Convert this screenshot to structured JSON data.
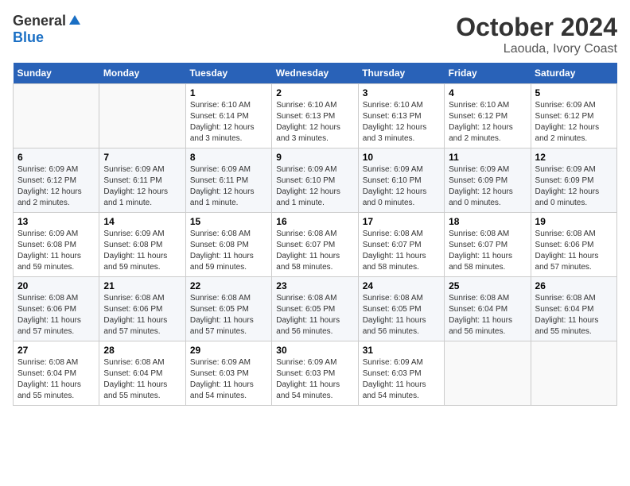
{
  "header": {
    "logo_general": "General",
    "logo_blue": "Blue",
    "title": "October 2024",
    "subtitle": "Laouda, Ivory Coast"
  },
  "weekdays": [
    "Sunday",
    "Monday",
    "Tuesday",
    "Wednesday",
    "Thursday",
    "Friday",
    "Saturday"
  ],
  "weeks": [
    [
      {
        "day": "",
        "info": ""
      },
      {
        "day": "",
        "info": ""
      },
      {
        "day": "1",
        "info": "Sunrise: 6:10 AM\nSunset: 6:14 PM\nDaylight: 12 hours and 3 minutes."
      },
      {
        "day": "2",
        "info": "Sunrise: 6:10 AM\nSunset: 6:13 PM\nDaylight: 12 hours and 3 minutes."
      },
      {
        "day": "3",
        "info": "Sunrise: 6:10 AM\nSunset: 6:13 PM\nDaylight: 12 hours and 3 minutes."
      },
      {
        "day": "4",
        "info": "Sunrise: 6:10 AM\nSunset: 6:12 PM\nDaylight: 12 hours and 2 minutes."
      },
      {
        "day": "5",
        "info": "Sunrise: 6:09 AM\nSunset: 6:12 PM\nDaylight: 12 hours and 2 minutes."
      }
    ],
    [
      {
        "day": "6",
        "info": "Sunrise: 6:09 AM\nSunset: 6:12 PM\nDaylight: 12 hours and 2 minutes."
      },
      {
        "day": "7",
        "info": "Sunrise: 6:09 AM\nSunset: 6:11 PM\nDaylight: 12 hours and 1 minute."
      },
      {
        "day": "8",
        "info": "Sunrise: 6:09 AM\nSunset: 6:11 PM\nDaylight: 12 hours and 1 minute."
      },
      {
        "day": "9",
        "info": "Sunrise: 6:09 AM\nSunset: 6:10 PM\nDaylight: 12 hours and 1 minute."
      },
      {
        "day": "10",
        "info": "Sunrise: 6:09 AM\nSunset: 6:10 PM\nDaylight: 12 hours and 0 minutes."
      },
      {
        "day": "11",
        "info": "Sunrise: 6:09 AM\nSunset: 6:09 PM\nDaylight: 12 hours and 0 minutes."
      },
      {
        "day": "12",
        "info": "Sunrise: 6:09 AM\nSunset: 6:09 PM\nDaylight: 12 hours and 0 minutes."
      }
    ],
    [
      {
        "day": "13",
        "info": "Sunrise: 6:09 AM\nSunset: 6:08 PM\nDaylight: 11 hours and 59 minutes."
      },
      {
        "day": "14",
        "info": "Sunrise: 6:09 AM\nSunset: 6:08 PM\nDaylight: 11 hours and 59 minutes."
      },
      {
        "day": "15",
        "info": "Sunrise: 6:08 AM\nSunset: 6:08 PM\nDaylight: 11 hours and 59 minutes."
      },
      {
        "day": "16",
        "info": "Sunrise: 6:08 AM\nSunset: 6:07 PM\nDaylight: 11 hours and 58 minutes."
      },
      {
        "day": "17",
        "info": "Sunrise: 6:08 AM\nSunset: 6:07 PM\nDaylight: 11 hours and 58 minutes."
      },
      {
        "day": "18",
        "info": "Sunrise: 6:08 AM\nSunset: 6:07 PM\nDaylight: 11 hours and 58 minutes."
      },
      {
        "day": "19",
        "info": "Sunrise: 6:08 AM\nSunset: 6:06 PM\nDaylight: 11 hours and 57 minutes."
      }
    ],
    [
      {
        "day": "20",
        "info": "Sunrise: 6:08 AM\nSunset: 6:06 PM\nDaylight: 11 hours and 57 minutes."
      },
      {
        "day": "21",
        "info": "Sunrise: 6:08 AM\nSunset: 6:06 PM\nDaylight: 11 hours and 57 minutes."
      },
      {
        "day": "22",
        "info": "Sunrise: 6:08 AM\nSunset: 6:05 PM\nDaylight: 11 hours and 57 minutes."
      },
      {
        "day": "23",
        "info": "Sunrise: 6:08 AM\nSunset: 6:05 PM\nDaylight: 11 hours and 56 minutes."
      },
      {
        "day": "24",
        "info": "Sunrise: 6:08 AM\nSunset: 6:05 PM\nDaylight: 11 hours and 56 minutes."
      },
      {
        "day": "25",
        "info": "Sunrise: 6:08 AM\nSunset: 6:04 PM\nDaylight: 11 hours and 56 minutes."
      },
      {
        "day": "26",
        "info": "Sunrise: 6:08 AM\nSunset: 6:04 PM\nDaylight: 11 hours and 55 minutes."
      }
    ],
    [
      {
        "day": "27",
        "info": "Sunrise: 6:08 AM\nSunset: 6:04 PM\nDaylight: 11 hours and 55 minutes."
      },
      {
        "day": "28",
        "info": "Sunrise: 6:08 AM\nSunset: 6:04 PM\nDaylight: 11 hours and 55 minutes."
      },
      {
        "day": "29",
        "info": "Sunrise: 6:09 AM\nSunset: 6:03 PM\nDaylight: 11 hours and 54 minutes."
      },
      {
        "day": "30",
        "info": "Sunrise: 6:09 AM\nSunset: 6:03 PM\nDaylight: 11 hours and 54 minutes."
      },
      {
        "day": "31",
        "info": "Sunrise: 6:09 AM\nSunset: 6:03 PM\nDaylight: 11 hours and 54 minutes."
      },
      {
        "day": "",
        "info": ""
      },
      {
        "day": "",
        "info": ""
      }
    ]
  ]
}
